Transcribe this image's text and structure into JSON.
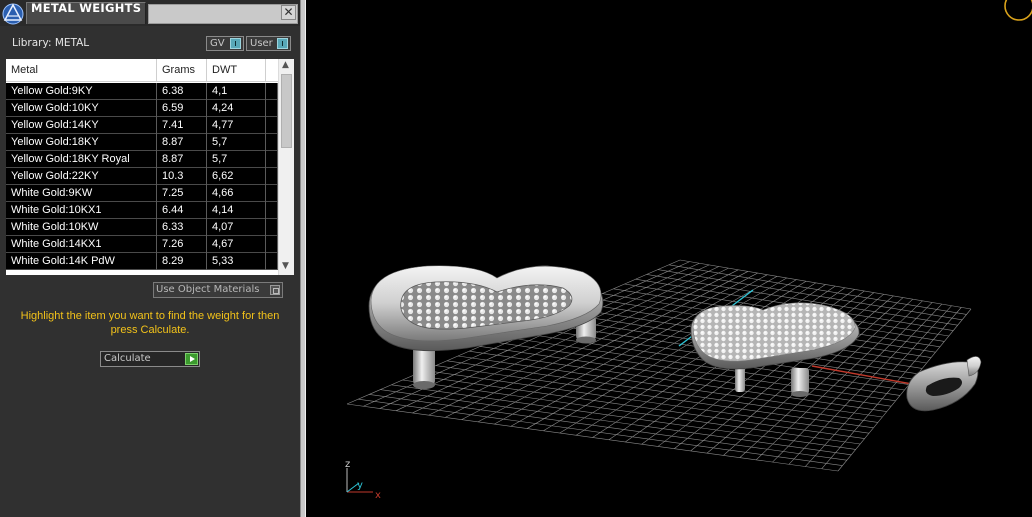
{
  "panel": {
    "title": "METAL WEIGHTS",
    "close_glyph": "✕",
    "library_label": "Library: METAL",
    "toggles": [
      {
        "label": "GV"
      },
      {
        "label": "User"
      }
    ],
    "table": {
      "columns": [
        "Metal",
        "Grams",
        "DWT"
      ],
      "rows": [
        {
          "metal": "Yellow Gold:9KY",
          "grams": "6.38",
          "dwt": "4,1"
        },
        {
          "metal": "Yellow Gold:10KY",
          "grams": "6.59",
          "dwt": "4,24"
        },
        {
          "metal": "Yellow Gold:14KY",
          "grams": "7.41",
          "dwt": "4,77"
        },
        {
          "metal": "Yellow Gold:18KY",
          "grams": "8.87",
          "dwt": "5,7"
        },
        {
          "metal": "Yellow Gold:18KY Royal",
          "grams": "8.87",
          "dwt": "5,7"
        },
        {
          "metal": "Yellow Gold:22KY",
          "grams": "10.3",
          "dwt": "6,62"
        },
        {
          "metal": "White Gold:9KW",
          "grams": "7.25",
          "dwt": "4,66"
        },
        {
          "metal": "White Gold:10KX1",
          "grams": "6.44",
          "dwt": "4,14"
        },
        {
          "metal": "White Gold:10KW",
          "grams": "6.33",
          "dwt": "4,07"
        },
        {
          "metal": "White Gold:14KX1",
          "grams": "7.26",
          "dwt": "4,67"
        },
        {
          "metal": "White Gold:14K PdW",
          "grams": "8.29",
          "dwt": "5,33"
        }
      ]
    },
    "use_object_materials_label": "Use Object Materials",
    "hint_text": "Highlight the item you want to find the weight for then press Calculate.",
    "calculate_label": "Calculate"
  },
  "viewport": {
    "axis_labels": {
      "z": "z",
      "y": "y",
      "x": "x"
    }
  },
  "colors": {
    "panel_bg": "#303030",
    "hint": "#f2c21a",
    "grid": "#8a8a8a",
    "x_axis": "#c0392b",
    "y_axis": "#2ec4d6",
    "calc_go": "#3c9a2e"
  },
  "icons": [
    "app-logo-icon",
    "close-icon",
    "scroll-up-icon",
    "scroll-down-icon",
    "play-arrow-icon",
    "orbit-ring-icon"
  ]
}
